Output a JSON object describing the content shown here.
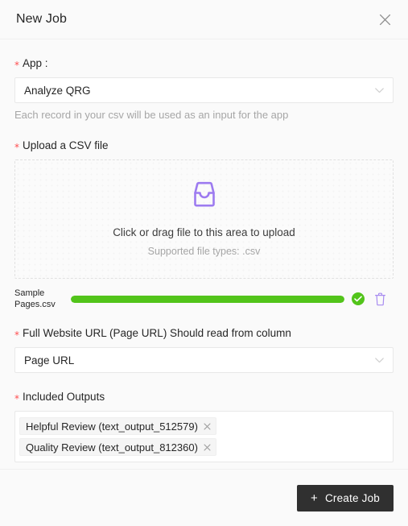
{
  "header": {
    "title": "New Job",
    "close_icon": "close-icon"
  },
  "form": {
    "app_field": {
      "label": "App :",
      "required_mark": "*",
      "value": "Analyze QRG",
      "hint": "Each record in your csv will be used as an input for the app",
      "chevron_icon": "chevron-down-icon"
    },
    "upload_field": {
      "label": "Upload a CSV file",
      "required_mark": "*",
      "icon": "inbox-tray-icon",
      "primary_text": "Click or drag file to this area to upload",
      "secondary_text": "Supported file types: .csv",
      "uploaded_file": {
        "name": "Sample Pages.csv",
        "progress_percent": 100,
        "status_icon": "check-circle-icon",
        "delete_icon": "trash-icon"
      }
    },
    "url_field": {
      "label": "Full Website URL (Page URL) Should read from column",
      "required_mark": "*",
      "value": "Page URL",
      "chevron_icon": "chevron-down-icon"
    },
    "outputs_field": {
      "label": "Included Outputs",
      "required_mark": "*",
      "tags": [
        {
          "label": "Helpful Review (text_output_512579)",
          "remove_icon": "close-icon"
        },
        {
          "label": "Quality Review (text_output_812360)",
          "remove_icon": "close-icon"
        }
      ]
    }
  },
  "footer": {
    "create_label": "Create Job",
    "plus_icon": "+"
  },
  "colors": {
    "accent_purple": "#9d7bf0",
    "success_green": "#52c41a",
    "required_red": "#ff4d4f",
    "button_dark": "#303030"
  }
}
